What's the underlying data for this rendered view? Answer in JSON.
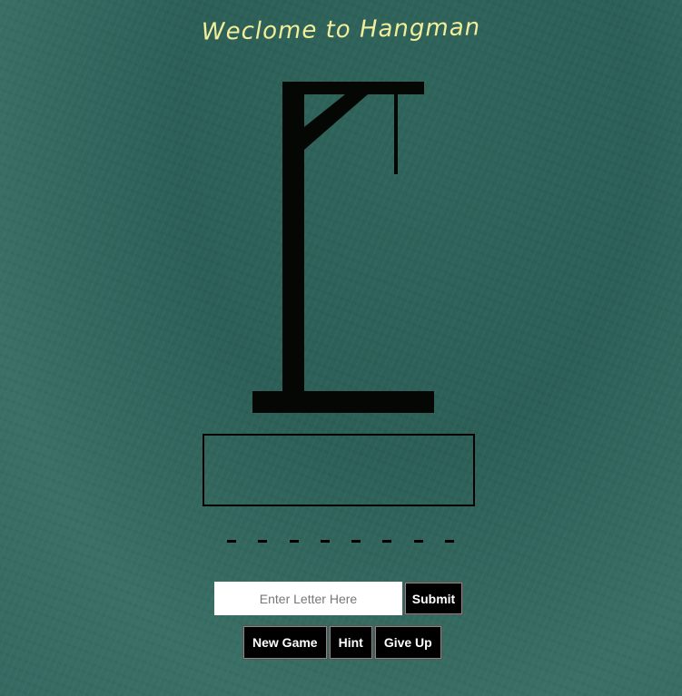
{
  "title": "Weclome to Hangman",
  "word": {
    "blank_count": 8
  },
  "input": {
    "placeholder": "Enter Letter Here",
    "value": ""
  },
  "buttons": {
    "submit": "Submit",
    "new_game": "New Game",
    "hint": "Hint",
    "give_up": "Give Up"
  },
  "colors": {
    "title": "#f2ee9a",
    "board": "#2f655c",
    "ink": "#000000"
  },
  "icons": {
    "gallows": "gallows-drawing"
  }
}
